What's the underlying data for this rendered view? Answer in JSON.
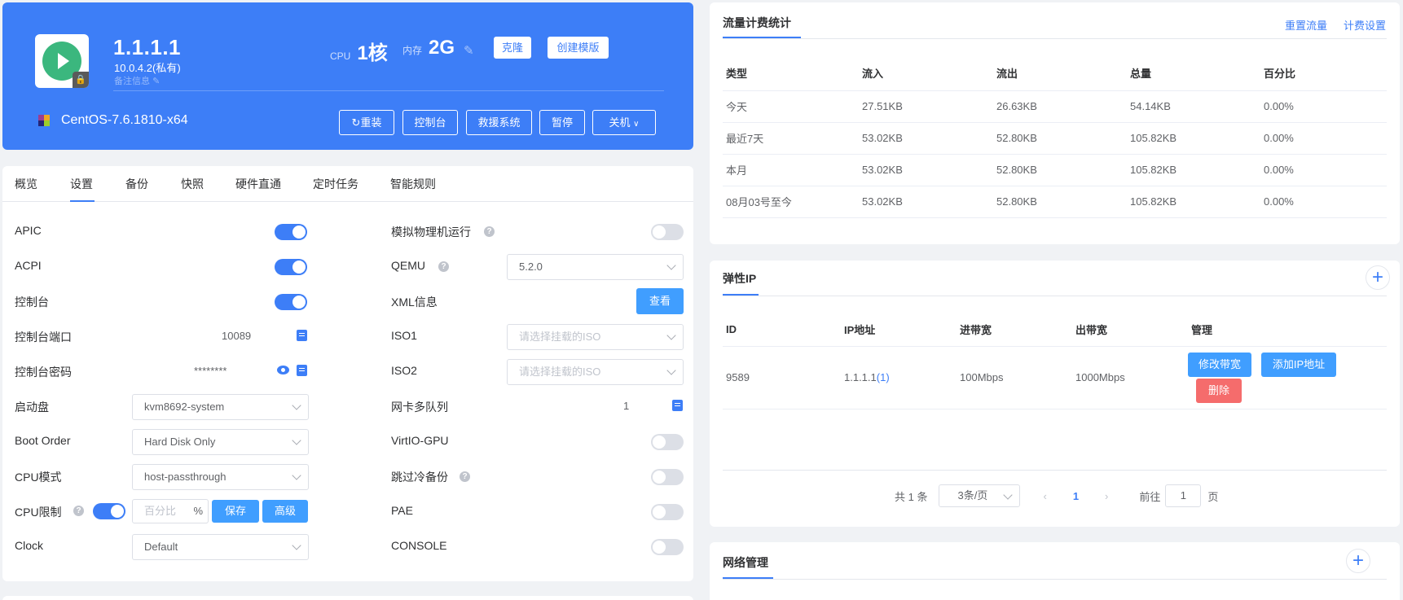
{
  "server": {
    "name": "1.1.1.1",
    "private_ip": "10.0.4.2(私有)",
    "remark_label": "备注信息",
    "cpu_label": "CPU",
    "cpu_value": "1核",
    "memory_label": "内存",
    "memory_value": "2G",
    "os": "CentOS-7.6.1810-x64",
    "buttons": {
      "clone": "克隆",
      "create_template": "创建模版",
      "reinstall": "重装",
      "console": "控制台",
      "rescue": "救援系统",
      "pause": "暂停",
      "shutdown": "关机"
    }
  },
  "tabs": [
    "概览",
    "设置",
    "备份",
    "快照",
    "硬件直通",
    "定时任务",
    "智能规则"
  ],
  "active_tab": "设置",
  "settings_left": {
    "apic": {
      "label": "APIC",
      "on": true
    },
    "acpi": {
      "label": "ACPI",
      "on": true
    },
    "console": {
      "label": "控制台",
      "on": true
    },
    "console_port": {
      "label": "控制台端口",
      "value": "10089"
    },
    "console_password": {
      "label": "控制台密码",
      "value": "********"
    },
    "boot_disk": {
      "label": "启动盘",
      "value": "kvm8692-system"
    },
    "boot_order": {
      "label": "Boot Order",
      "value": "Hard Disk Only"
    },
    "cpu_mode": {
      "label": "CPU模式",
      "value": "host-passthrough"
    },
    "cpu_limit": {
      "label": "CPU限制",
      "on": true,
      "placeholder": "百分比",
      "unit": "%",
      "save": "保存",
      "advanced": "高级"
    },
    "clock": {
      "label": "Clock",
      "value": "Default"
    }
  },
  "settings_right": {
    "simulate_physical": {
      "label": "模拟物理机运行",
      "on": false
    },
    "qemu": {
      "label": "QEMU",
      "value": "5.2.0"
    },
    "xml": {
      "label": "XML信息",
      "button": "查看"
    },
    "iso1": {
      "label": "ISO1",
      "placeholder": "请选择挂载的ISO"
    },
    "iso2": {
      "label": "ISO2",
      "placeholder": "请选择挂载的ISO"
    },
    "nic_queue": {
      "label": "网卡多队列",
      "value": "1"
    },
    "virtio_gpu": {
      "label": "VirtIO-GPU",
      "on": false
    },
    "skip_cold_backup": {
      "label": "跳过冷备份",
      "on": false
    },
    "pae": {
      "label": "PAE",
      "on": false
    },
    "console_opt": {
      "label": "CONSOLE",
      "on": false
    }
  },
  "traffic": {
    "title": "流量计费统计",
    "reset_link": "重置流量",
    "billing_link": "计费设置",
    "columns": [
      "类型",
      "流入",
      "流出",
      "总量",
      "百分比"
    ],
    "rows": [
      [
        "今天",
        "27.51KB",
        "26.63KB",
        "54.14KB",
        "0.00%"
      ],
      [
        "最近7天",
        "53.02KB",
        "52.80KB",
        "105.82KB",
        "0.00%"
      ],
      [
        "本月",
        "53.02KB",
        "52.80KB",
        "105.82KB",
        "0.00%"
      ],
      [
        "08月03号至今",
        "53.02KB",
        "52.80KB",
        "105.82KB",
        "0.00%"
      ]
    ]
  },
  "elastic_ip": {
    "title": "弹性IP",
    "columns": [
      "ID",
      "IP地址",
      "进带宽",
      "出带宽",
      "管理"
    ],
    "row": {
      "id": "9589",
      "ip": "1.1.1.1",
      "ip_count": "(1)",
      "in_bw": "100Mbps",
      "out_bw": "1000Mbps"
    },
    "buttons": {
      "modify_bw": "修改带宽",
      "add_ip": "添加IP地址",
      "delete": "删除"
    },
    "pager": {
      "total": "共 1 条",
      "page_size": "3条/页",
      "current": "1",
      "goto_prefix": "前往",
      "goto_value": "1",
      "goto_suffix": "页"
    }
  },
  "network": {
    "title": "网络管理"
  },
  "colors": {
    "primary": "#3d7ef7",
    "button": "#409eff",
    "danger": "#f56c6c",
    "on_switch": "#3d7ef7"
  }
}
